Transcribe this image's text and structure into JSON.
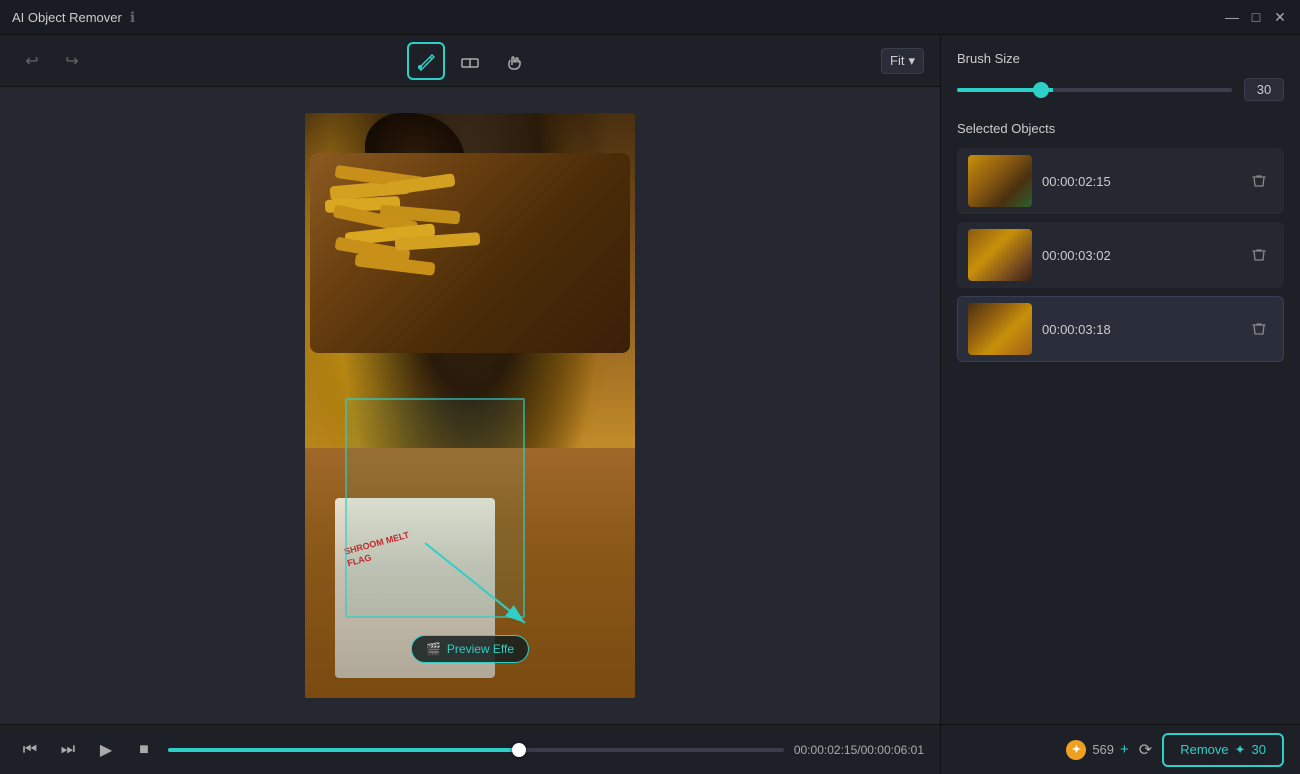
{
  "app": {
    "title": "AI Object Remover",
    "info_icon": "ℹ"
  },
  "titlebar": {
    "minimize_label": "—",
    "maximize_label": "□",
    "close_label": "✕"
  },
  "toolbar": {
    "undo_label": "↩",
    "redo_label": "↪",
    "brush_tool_label": "✏",
    "eraser_tool_label": "◌",
    "pan_tool_label": "✋",
    "fit_label": "Fit",
    "fit_chevron": "▾"
  },
  "canvas": {
    "preview_button_label": "Preview Effe",
    "preview_icon": "🎬"
  },
  "playback": {
    "skip_back_label": "⏮",
    "step_back_label": "⏭",
    "play_label": "▶",
    "stop_label": "■",
    "current_time": "00:00:02:15",
    "total_time": "00:00:06:01",
    "time_separator": "/",
    "time_display": "00:00:02:15/00:00:06:01",
    "progress_percent": 57
  },
  "right_panel": {
    "brush_size_label": "Brush Size",
    "brush_value": "30",
    "selected_objects_label": "Selected Objects",
    "objects": [
      {
        "id": 1,
        "timestamp": "00:00:02:15",
        "thumb_class": "thumb-1"
      },
      {
        "id": 2,
        "timestamp": "00:00:03:02",
        "thumb_class": "thumb-2"
      },
      {
        "id": 3,
        "timestamp": "00:00:03:18",
        "thumb_class": "thumb-3",
        "active": true
      }
    ]
  },
  "action_bar": {
    "credits_count": "569",
    "credits_plus": "+",
    "remove_label": "Remove",
    "remove_count": "30",
    "remove_icon": "✦"
  }
}
